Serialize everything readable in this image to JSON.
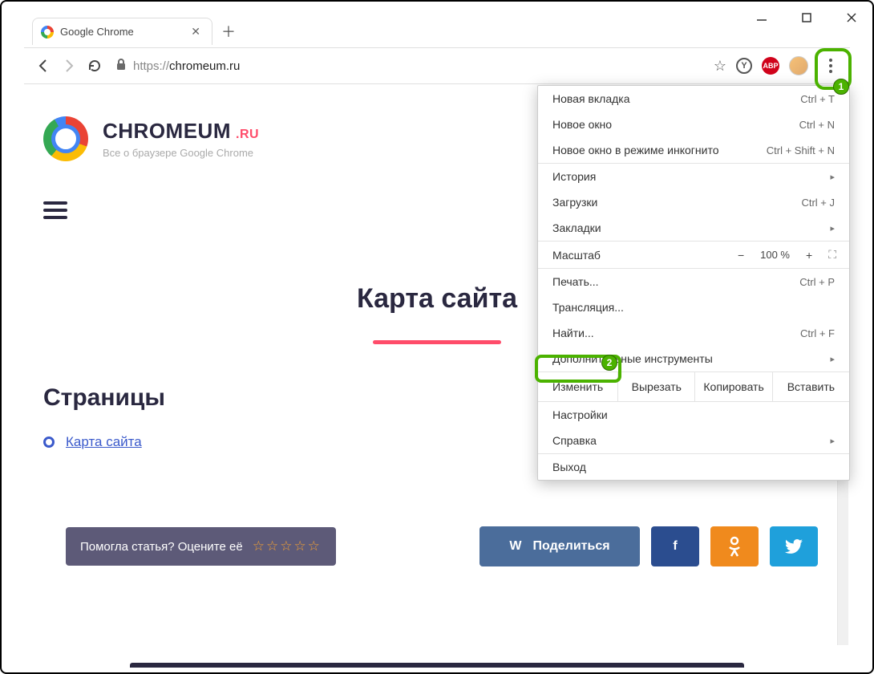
{
  "window_controls": {
    "min": "—",
    "max": "□",
    "close": "✕"
  },
  "tab": {
    "title": "Google Chrome"
  },
  "url": {
    "protocol": "https://",
    "host": "chromeum.ru"
  },
  "ext_yandex": "Y",
  "ext_abp": "ABP",
  "site": {
    "brand": "CHROMEUM",
    "tld": ".RU",
    "subtitle": "Все о браузере Google Chrome",
    "sitemap_title": "Карта сайта",
    "section_pages": "Страницы",
    "link_sitemap": "Карта сайта"
  },
  "rate": {
    "label": "Помогла статья? Оцените её",
    "stars": "☆☆☆☆☆"
  },
  "share": {
    "vk": "Поделиться",
    "fb": "f",
    "ok": "ꙮ",
    "tw": "🐦"
  },
  "menu": {
    "new_tab": {
      "label": "Новая вкладка",
      "shortcut": "Ctrl + T"
    },
    "new_window": {
      "label": "Новое окно",
      "shortcut": "Ctrl + N"
    },
    "incognito": {
      "label": "Новое окно в режиме инкогнито",
      "shortcut": "Ctrl + Shift + N"
    },
    "history": {
      "label": "История"
    },
    "downloads": {
      "label": "Загрузки",
      "shortcut": "Ctrl + J"
    },
    "bookmarks": {
      "label": "Закладки"
    },
    "zoom": {
      "label": "Масштаб",
      "value": "100 %"
    },
    "print": {
      "label": "Печать...",
      "shortcut": "Ctrl + P"
    },
    "cast": {
      "label": "Трансляция..."
    },
    "find": {
      "label": "Найти...",
      "shortcut": "Ctrl + F"
    },
    "more_tools": {
      "label": "Дополнительные инструменты"
    },
    "edit": {
      "label": "Изменить",
      "cut": "Вырезать",
      "copy": "Копировать",
      "paste": "Вставить"
    },
    "settings": {
      "label": "Настройки"
    },
    "help": {
      "label": "Справка"
    },
    "exit": {
      "label": "Выход"
    }
  },
  "annot": {
    "b1": "1",
    "b2": "2"
  }
}
